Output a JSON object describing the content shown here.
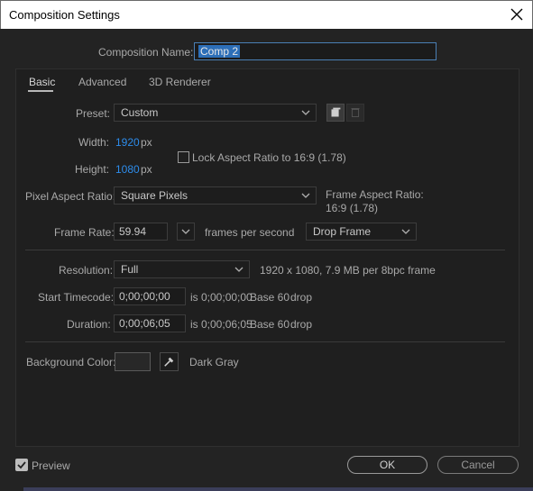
{
  "window": {
    "title": "Composition Settings"
  },
  "comp_name": {
    "label": "Composition Name:",
    "value": "Comp 2"
  },
  "tabs": [
    {
      "label": "Basic",
      "active": true
    },
    {
      "label": "Advanced",
      "active": false
    },
    {
      "label": "3D Renderer",
      "active": false
    }
  ],
  "preset": {
    "label": "Preset:",
    "value": "Custom"
  },
  "width": {
    "label": "Width:",
    "value": "1920",
    "unit": "px"
  },
  "height": {
    "label": "Height:",
    "value": "1080",
    "unit": "px"
  },
  "lock_aspect": {
    "label": "Lock Aspect Ratio to 16:9 (1.78)",
    "checked": false
  },
  "pixel_aspect": {
    "label": "Pixel Aspect Ratio:",
    "value": "Square Pixels"
  },
  "frame_aspect": {
    "label": "Frame Aspect Ratio:",
    "value": "16:9 (1.78)"
  },
  "frame_rate": {
    "label": "Frame Rate:",
    "value": "59.94",
    "unit": "frames per second",
    "drop_frame": "Drop Frame"
  },
  "resolution": {
    "label": "Resolution:",
    "value": "Full",
    "info": "1920 x 1080, 7.9 MB per 8bpc frame"
  },
  "start_timecode": {
    "label": "Start Timecode:",
    "value": "0;00;00;00",
    "is": "is 0;00;00;00",
    "base": "Base 60",
    "drop": "drop"
  },
  "duration": {
    "label": "Duration:",
    "value": "0;00;06;05",
    "is": "is 0;00;06;05",
    "base": "Base 60",
    "drop": "drop"
  },
  "background": {
    "label": "Background Color:",
    "color_name": "Dark Gray",
    "swatch": "#282828"
  },
  "preview": {
    "label": "Preview",
    "checked": true
  },
  "buttons": {
    "ok": "OK",
    "cancel": "Cancel"
  },
  "colors": {
    "accent_blue": "#2d8ceb",
    "selection": "#2d6fb8"
  }
}
